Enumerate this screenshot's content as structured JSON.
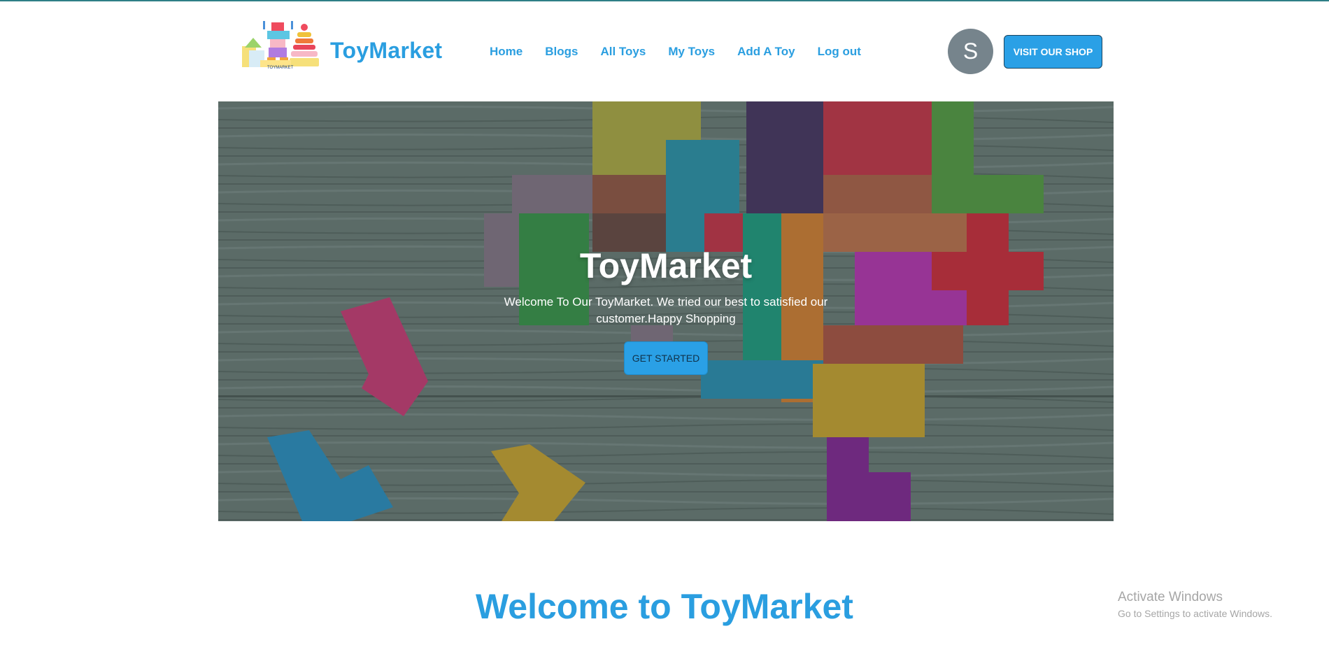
{
  "brand": {
    "name": "ToyMarket",
    "logo_caption": "TOYMARKET"
  },
  "nav": {
    "items": [
      "Home",
      "Blogs",
      "All Toys",
      "My Toys",
      "Add A Toy",
      "Log out"
    ]
  },
  "user": {
    "avatar_initial": "S"
  },
  "header": {
    "shop_button": "VISIT OUR SHOP"
  },
  "hero": {
    "title": "ToyMarket",
    "text": "Welcome To Our ToyMarket. We tried our best to satisfied our customer.Happy Shopping",
    "button": "GET STARTED"
  },
  "welcome": {
    "title": "Welcome to ToyMarket"
  },
  "windows": {
    "line1": "Activate Windows",
    "line2": "Go to Settings to activate Windows."
  },
  "colors": {
    "accent": "#2a9ee0",
    "button": "#2aa0e6",
    "avatar": "#76848c"
  }
}
